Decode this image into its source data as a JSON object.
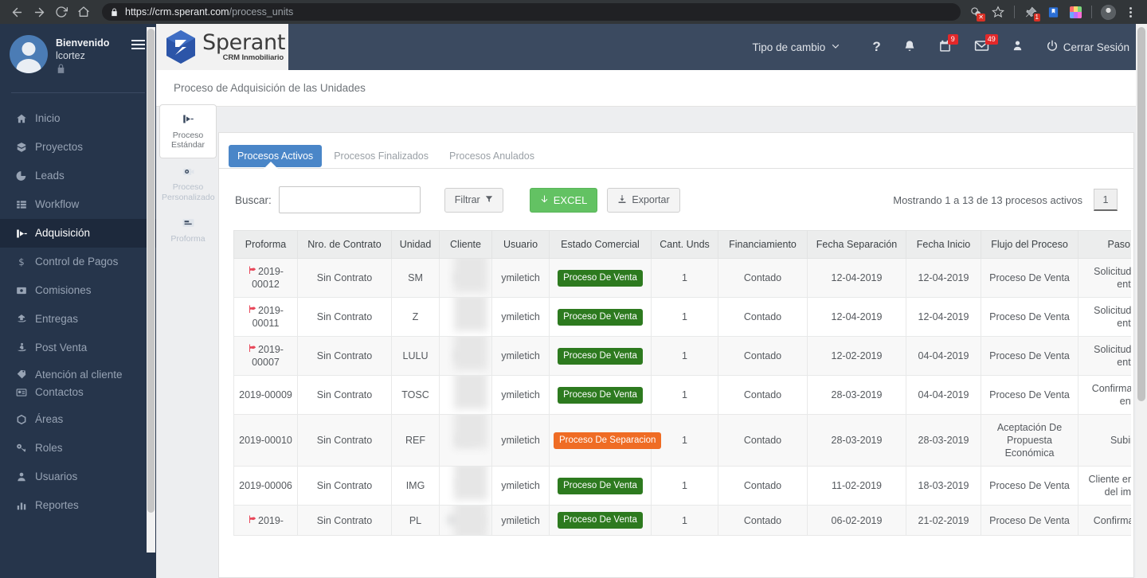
{
  "browser": {
    "url_scheme": "https://crm.sperant.com",
    "url_path": "/process_units",
    "back_icon": "back-arrow-icon",
    "forward_icon": "forward-arrow-icon",
    "reload_icon": "reload-icon",
    "home_icon": "home-icon",
    "lock_icon": "lock-icon",
    "extension_badge": "1"
  },
  "sidebar": {
    "welcome": "Bienvenido",
    "username": "lcortez",
    "lock_icon": "lock-icon",
    "menu_icon": "hamburger-icon",
    "items": [
      {
        "label": "Inicio",
        "icon": "home-icon",
        "active": false
      },
      {
        "label": "Proyectos",
        "icon": "box-icon",
        "active": false
      },
      {
        "label": "Leads",
        "icon": "pie-chart-icon",
        "active": false
      },
      {
        "label": "Workflow",
        "icon": "grid-icon",
        "active": false
      },
      {
        "label": "Adquisición",
        "icon": "inbox-arrow-icon",
        "active": true
      },
      {
        "label": "Control de Pagos",
        "icon": "dollar-icon",
        "active": false
      },
      {
        "label": "Comisiones",
        "icon": "money-bill-icon",
        "active": false
      },
      {
        "label": "Entregas",
        "icon": "hand-house-icon",
        "active": false
      },
      {
        "label": "Post Venta",
        "icon": "hand-person-icon",
        "active": false
      },
      {
        "label": "Atención al cliente",
        "icon": "tag-icon",
        "active": false
      },
      {
        "label": "Contactos",
        "icon": "id-card-icon",
        "active": false
      },
      {
        "label": "Áreas",
        "icon": "hexagon-icon",
        "active": false
      },
      {
        "label": "Roles",
        "icon": "key-icon",
        "active": false
      },
      {
        "label": "Usuarios",
        "icon": "user-icon",
        "active": false
      },
      {
        "label": "Reportes",
        "icon": "bar-chart-icon",
        "active": false
      }
    ]
  },
  "header": {
    "logo_name": "Sperant",
    "logo_tagline": "CRM Inmobiliario",
    "exchange_rate_label": "Tipo de cambio",
    "help_icon": "question-mark-icon",
    "bell_icon": "bell-icon",
    "calendar_icon": "calendar-icon",
    "calendar_badge": "9",
    "mail_icon": "envelope-icon",
    "mail_badge": "49",
    "user_icon": "user-icon",
    "logout_icon": "power-icon",
    "logout_label": "Cerrar Sesión"
  },
  "page": {
    "title": "Proceso de Adquisición de las Unidades"
  },
  "vtabs": [
    {
      "label": "Proceso Estándar",
      "icon": "inbox-arrow-icon",
      "active": true
    },
    {
      "label": "Proceso Personalizado",
      "icon": "gear-camera-icon",
      "active": false
    },
    {
      "label": "Proforma",
      "icon": "document-icon",
      "active": false
    }
  ],
  "tabs": [
    {
      "label": "Procesos Activos",
      "active": true
    },
    {
      "label": "Procesos Finalizados",
      "active": false
    },
    {
      "label": "Procesos Anulados",
      "active": false
    }
  ],
  "toolbar": {
    "search_label": "Buscar:",
    "search_value": "",
    "search_placeholder": "",
    "filter_label": "Filtrar",
    "filter_icon": "funnel-icon",
    "excel_label": "EXCEL",
    "excel_icon": "down-arrow-icon",
    "export_label": "Exportar",
    "export_icon": "download-icon",
    "showing_text": "Mostrando 1 a 13 de 13 procesos activos",
    "page_number": "1"
  },
  "table": {
    "columns": [
      "Proforma",
      "Nro. de Contrato",
      "Unidad",
      "Cliente",
      "Usuario",
      "Estado Comercial",
      "Cant. Unds",
      "Financiamiento",
      "Fecha Separación",
      "Fecha Inicio",
      "Flujo del Proceso",
      "Paso Actual"
    ],
    "rows": [
      {
        "flag": true,
        "proforma": "2019-00012",
        "contrato": "Sin Contrato",
        "unidad": "SM",
        "cliente": "UTO",
        "usuario": "ymiletich",
        "estado": "Proceso De Venta",
        "estado_type": "venta",
        "cant": "1",
        "financiamiento": "Contado",
        "fecha_sep": "12-04-2019",
        "fecha_ini": "12-04-2019",
        "flujo": "Proceso De Venta",
        "paso": "Solicitud Creación entorno"
      },
      {
        "flag": true,
        "proforma": "2019-00011",
        "contrato": "Sin Contrato",
        "unidad": "Z",
        "cliente": "",
        "usuario": "ymiletich",
        "estado": "Proceso De Venta",
        "estado_type": "venta",
        "cant": "1",
        "financiamiento": "Contado",
        "fecha_sep": "12-04-2019",
        "fecha_ini": "12-04-2019",
        "flujo": "Proceso De Venta",
        "paso": "Solicitud Creación entorno"
      },
      {
        "flag": true,
        "proforma": "2019-00007",
        "contrato": "Sin Contrato",
        "unidad": "LULU",
        "cliente": "DI           in",
        "usuario": "ymiletich",
        "estado": "Proceso De Venta",
        "estado_type": "venta",
        "cant": "1",
        "financiamiento": "Contado",
        "fecha_sep": "12-02-2019",
        "fecha_ini": "04-04-2019",
        "flujo": "Proceso De Venta",
        "paso": "Solicitud Creación entorno"
      },
      {
        "flag": false,
        "proforma": "2019-00009",
        "contrato": "Sin Contrato",
        "unidad": "TOSC",
        "cliente": "S",
        "usuario": "ymiletich",
        "estado": "Proceso De Venta",
        "estado_type": "venta",
        "cant": "1",
        "financiamiento": "Contado",
        "fecha_sep": "28-03-2019",
        "fecha_ini": "04-04-2019",
        "flujo": "Proceso De Venta",
        "paso": "Confirmar creación entorn"
      },
      {
        "flag": false,
        "proforma": "2019-00010",
        "contrato": "Sin Contrato",
        "unidad": "REF",
        "cliente": "A          O",
        "usuario": "ymiletich",
        "estado": "Proceso De Separacion",
        "estado_type": "separacion",
        "cant": "1",
        "financiamiento": "Contado",
        "fecha_sep": "28-03-2019",
        "fecha_ini": "28-03-2019",
        "flujo": "Aceptación De Propuesta Económica",
        "paso": "Subir Cont"
      },
      {
        "flag": false,
        "proforma": "2019-00006",
        "contrato": "Sin Contrato",
        "unidad": "IMG",
        "cliente": "T        E",
        "usuario": "ymiletich",
        "estado": "Proceso De Venta",
        "estado_type": "venta",
        "cant": "1",
        "financiamiento": "Contado",
        "fecha_sep": "11-02-2019",
        "fecha_ini": "18-03-2019",
        "flujo": "Proceso De Venta",
        "paso": "Cliente env informac del implantac"
      },
      {
        "flag": true,
        "proforma": "2019-",
        "contrato": "Sin Contrato",
        "unidad": "PL",
        "cliente": "ROZAS",
        "usuario": "ymiletich",
        "estado": "Proceso De Venta",
        "estado_type": "venta",
        "cant": "1",
        "financiamiento": "Contado",
        "fecha_sep": "06-02-2019",
        "fecha_ini": "21-02-2019",
        "flujo": "Proceso De Venta",
        "paso": "Confirma creación"
      }
    ]
  },
  "colors": {
    "sidebar_bg": "#26354b",
    "topbar_bg": "#3b4a60",
    "accent_blue": "#4a86c8",
    "green_badge": "#2d7a1f",
    "orange_badge": "#ef6c24",
    "excel_green": "#63c263",
    "flag_red": "#e8495b"
  }
}
